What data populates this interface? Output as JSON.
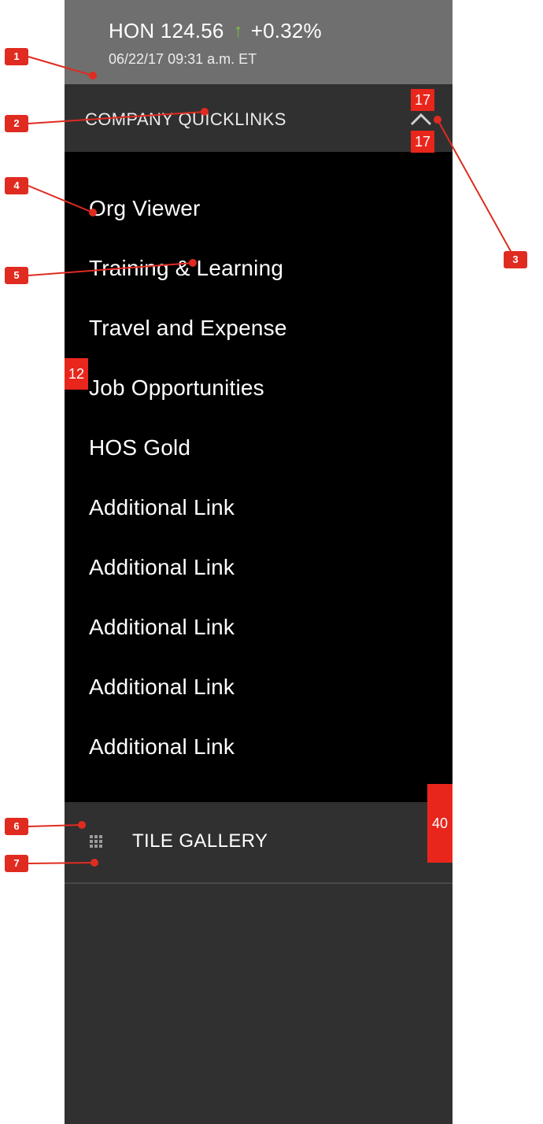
{
  "ticker": {
    "symbol": "HON",
    "price": "124.56",
    "arrow": "↑",
    "change": "+0.32%",
    "timestamp": "06/22/17 09:31 a.m. ET",
    "up_color": "#7bc142"
  },
  "quicklinks": {
    "title": "COMPANY QUICKLINKS",
    "toggle_icon": "chevron-up-icon",
    "items": [
      {
        "label": "Org Viewer"
      },
      {
        "label": "Training & Learning"
      },
      {
        "label": "Travel and Expense"
      },
      {
        "label": "Job Opportunities"
      },
      {
        "label": "HOS Gold"
      },
      {
        "label": "Additional Link"
      },
      {
        "label": "Additional Link"
      },
      {
        "label": "Additional Link"
      },
      {
        "label": "Additional Link"
      },
      {
        "label": "Additional Link"
      }
    ]
  },
  "tile_gallery": {
    "label": "TILE GALLERY",
    "icon": "grid-icon"
  },
  "annotations": {
    "badges": [
      "1",
      "2",
      "3",
      "4",
      "5",
      "6",
      "7"
    ],
    "spacing": {
      "chevron_top": "17",
      "chevron_bottom": "17",
      "link_left": "12",
      "tile_row_height": "40"
    },
    "accent": "#e02b20"
  }
}
